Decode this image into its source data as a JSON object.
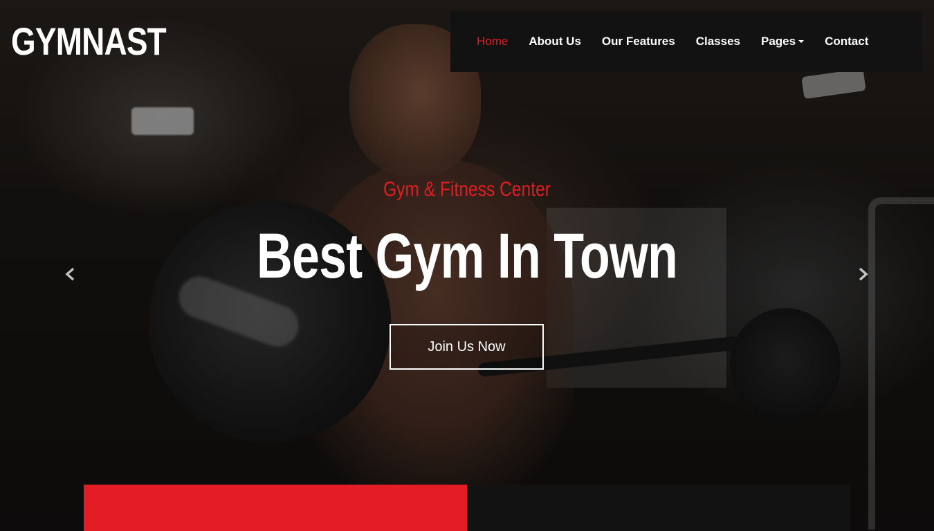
{
  "brand": {
    "logo_text": "GYMNAST"
  },
  "nav": {
    "items": [
      {
        "label": "Home",
        "active": true
      },
      {
        "label": "About Us"
      },
      {
        "label": "Our Features"
      },
      {
        "label": "Classes"
      },
      {
        "label": "Pages",
        "has_dropdown": true
      },
      {
        "label": "Contact"
      }
    ]
  },
  "hero": {
    "subtitle": "Gym & Fitness Center",
    "title": "Best Gym In Town",
    "cta_label": "Join Us Now",
    "prev_icon": "chevron-left-icon",
    "next_icon": "chevron-right-icon"
  },
  "colors": {
    "accent": "#e31c25",
    "nav_bg": "#121212",
    "text": "#ffffff"
  }
}
